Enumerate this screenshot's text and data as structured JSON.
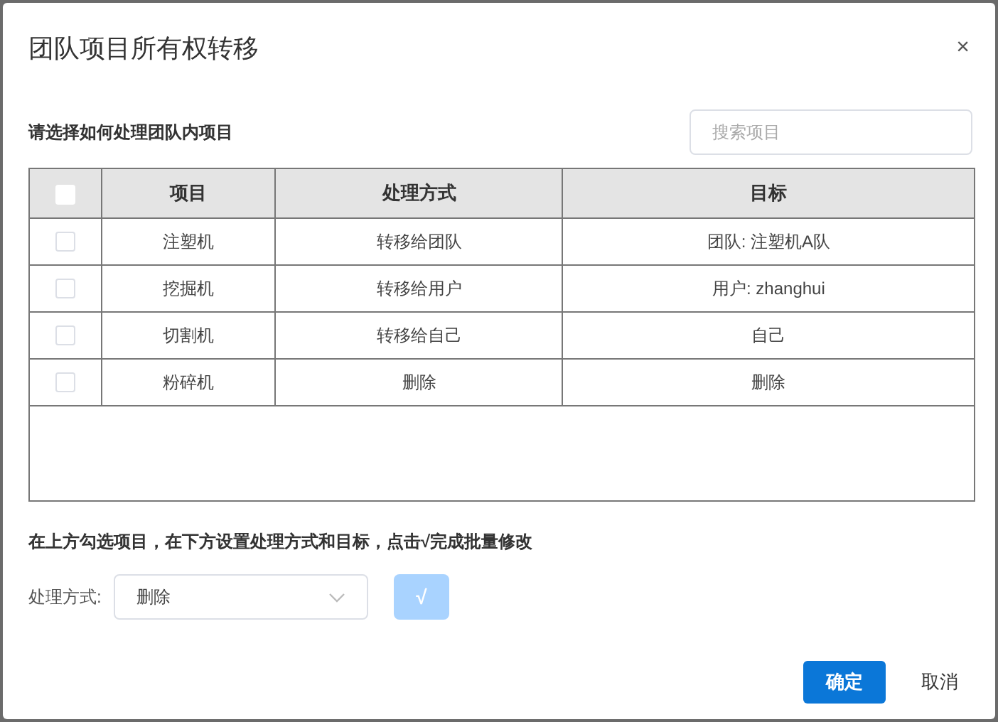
{
  "dialog": {
    "title": "团队项目所有权转移",
    "close": "×"
  },
  "section_label": "请选择如何处理团队内项目",
  "search": {
    "placeholder": "搜索项目"
  },
  "table": {
    "select_all_checked": false,
    "columns": [
      "项目",
      "处理方式",
      "目标"
    ],
    "rows": [
      {
        "checked": false,
        "cells": [
          "注塑机",
          "转移给团队",
          "团队: 注塑机A队"
        ]
      },
      {
        "checked": false,
        "cells": [
          "挖掘机",
          "转移给用户",
          "用户: zhanghui"
        ]
      },
      {
        "checked": false,
        "cells": [
          "切割机",
          "转移给自己",
          "自己"
        ]
      },
      {
        "checked": false,
        "cells": [
          "粉碎机",
          "删除",
          "删除"
        ]
      }
    ]
  },
  "instruction": "在上方勾选项目，在下方设置处理方式和目标，点击√完成批量修改",
  "batch": {
    "label": "处理方式:",
    "value": "删除",
    "apply_button": {
      "label": "√",
      "disabled": true
    }
  },
  "buttons": {
    "ok": "确定",
    "cancel": "取消"
  }
}
